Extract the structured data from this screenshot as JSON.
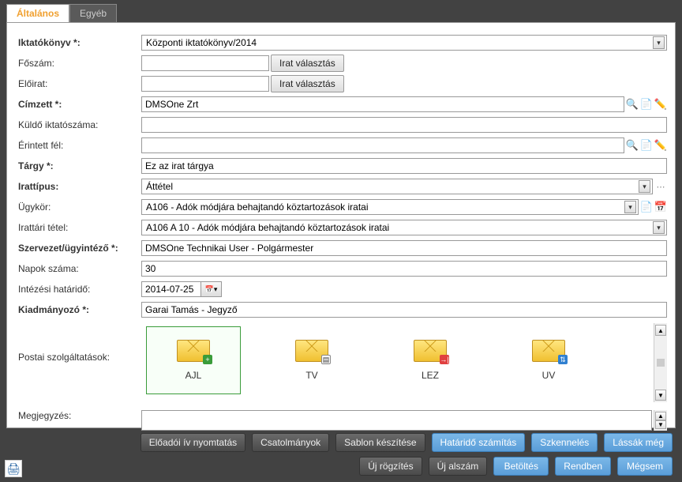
{
  "tabs": {
    "general": "Általános",
    "other": "Egyéb"
  },
  "labels": {
    "iktatokonyv": "Iktatókönyv *:",
    "foszam": "Főszám:",
    "eloirat": "Előirat:",
    "cimzett": "Címzett *:",
    "kuldo": "Küldő iktatószáma:",
    "erintett": "Érintett fél:",
    "targy": "Tárgy *:",
    "irattipus": "Irattípus:",
    "ugykor": "Ügykör:",
    "irattari": "Irattári tétel:",
    "szervezet": "Szervezet/ügyintéző *:",
    "napok": "Napok száma:",
    "intezesi": "Intézési határidő:",
    "kiadmanyozo": "Kiadmányozó *:",
    "postai": "Postai szolgáltatások:",
    "megjegyzes": "Megjegyzés:"
  },
  "values": {
    "iktatokonyv": "Központi iktatókönyv/2014",
    "foszam": "",
    "eloirat": "",
    "cimzett": "DMSOne Zrt",
    "kuldo": "",
    "erintett": "",
    "targy": "Ez az irat tárgya",
    "irattipus": "Áttétel",
    "ugykor": "A106 - Adók módjára behajtandó köztartozások iratai",
    "irattari": "A106 A 10 - Adók módjára behajtandó köztartozások iratai",
    "szervezet": "DMSOne Technikai User - Polgármester",
    "napok": "30",
    "intezesi": "2014-07-25",
    "kiadmanyozo": "Garai Tamás - Jegyző",
    "megjegyzes": ""
  },
  "buttons": {
    "irat_valasztas": "Irat választás",
    "eloadoi": "Előadói ív nyomtatás",
    "csatolmanyok": "Csatolmányok",
    "sablon": "Sablon készítése",
    "hatarido": "Határidő számítás",
    "szkenneles": "Szkennelés",
    "lassak": "Lássák még",
    "uj_rogzites": "Új rögzítés",
    "uj_alszam": "Új alszám",
    "betoltes": "Betöltés",
    "rendben": "Rendben",
    "megsem": "Mégsem"
  },
  "postal": {
    "ajl": "AJL",
    "tv": "TV",
    "lez": "LEZ",
    "uv": "UV"
  }
}
